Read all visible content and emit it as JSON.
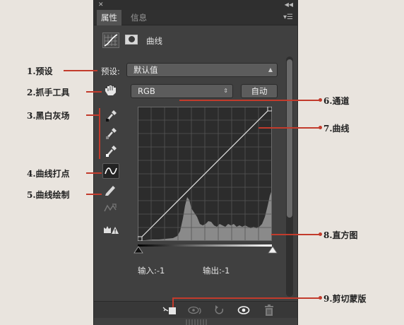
{
  "panel": {
    "tabs": [
      "属性",
      "信息"
    ],
    "header_title": "曲线",
    "preset": {
      "label": "预设:",
      "value": "默认值"
    },
    "channel": {
      "value": "RGB"
    },
    "auto_button": "自动",
    "input_readout": "输入:-1",
    "output_readout": "输出:-1"
  },
  "annotations": {
    "preset": "1.预设",
    "hand_tool": "2.抓手工具",
    "eyedroppers": "3.黑白灰场",
    "curve_point": "4.曲线打点",
    "curve_draw": "5.曲线绘制",
    "channel": "6.通道",
    "curve": "7.曲线",
    "histogram": "8.直方图",
    "clip": "9.剪切蒙版"
  },
  "colors": {
    "panel_bg": "#404040",
    "annotation_line": "#c23b2c",
    "page_bg": "#e9e4de"
  },
  "icons": [
    "close-icon",
    "collapse-icon",
    "panel-menu-icon",
    "curves-adjustment-icon",
    "mask-icon",
    "hand-tool-icon",
    "black-eyedropper-icon",
    "gray-eyedropper-icon",
    "white-eyedropper-icon",
    "curve-point-icon",
    "pencil-icon",
    "smooth-icon",
    "clipping-warning-icon",
    "clip-to-layer-icon",
    "view-previous-icon",
    "reset-icon",
    "visibility-icon",
    "trash-icon"
  ]
}
